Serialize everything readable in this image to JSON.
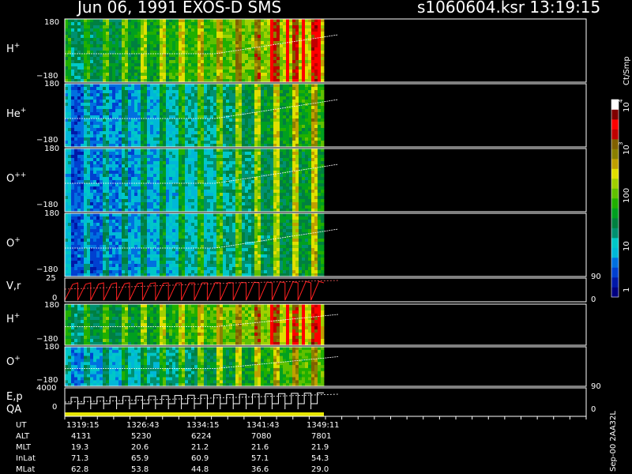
{
  "header": {
    "title": "Jun 06, 1991   EXOS-D SMS",
    "file": "s1060604.ksr  13:19:15"
  },
  "colorbar": {
    "unit": "Ct/Smp",
    "colors": [
      "#000080",
      "#0018a8",
      "#0040d0",
      "#0070e0",
      "#00b8d8",
      "#00c8c8",
      "#009070",
      "#008040",
      "#00a020",
      "#20b000",
      "#60c000",
      "#a0d000",
      "#e0e000",
      "#c0a000",
      "#8a8000",
      "#806000",
      "#c00000",
      "#ff0000",
      "#800000",
      "#ffffff"
    ],
    "tick_labels": [
      "1",
      "10",
      "100",
      "10",
      "3",
      "10",
      "4"
    ]
  },
  "panels": [
    {
      "id": "h-plus",
      "species": "H",
      "charge": "+",
      "y_top": "180",
      "y_bottom": "−180"
    },
    {
      "id": "he-plus",
      "species": "He",
      "charge": "+",
      "y_top": "180",
      "y_bottom": "−180"
    },
    {
      "id": "o-plusplus",
      "species": "O",
      "charge": "++",
      "y_top": "180",
      "y_bottom": "−180"
    },
    {
      "id": "o-plus",
      "species": "O",
      "charge": "+",
      "y_top": "180",
      "y_bottom": "−180"
    },
    {
      "id": "vr",
      "label": "V,r",
      "y_top": "25",
      "y_bottom": "0",
      "right_top": "90",
      "right_bottom": "0"
    },
    {
      "id": "h-plus-2",
      "species": "H",
      "charge": "+",
      "y_top": "180",
      "y_bottom": "−180"
    },
    {
      "id": "o-plus-2",
      "species": "O",
      "charge": "+",
      "y_top": "180",
      "y_bottom": "−180"
    },
    {
      "id": "ep-qa",
      "label": "E,p",
      "label2": "QA",
      "y_top": "4000",
      "y_bottom": "0",
      "right_top": "90",
      "right_bottom": "0"
    }
  ],
  "footer": {
    "rows": [
      {
        "name": "UT",
        "values": [
          "1319:15",
          "1326:43",
          "1334:15",
          "1341:43",
          "1349:11"
        ]
      },
      {
        "name": "ALT",
        "values": [
          "4131",
          "5230",
          "6224",
          "7080",
          "7801"
        ]
      },
      {
        "name": "MLT",
        "values": [
          "19.3",
          "20.6",
          "21.2",
          "21.6",
          "21.9"
        ]
      },
      {
        "name": "InLat",
        "values": [
          "71.3",
          "65.9",
          "60.9",
          "57.1",
          "54.3"
        ]
      },
      {
        "name": "MLat",
        "values": [
          "62.8",
          "53.8",
          "44.8",
          "36.6",
          "29.0"
        ]
      }
    ],
    "stamp": "Sep-00  2AA32L"
  },
  "chart_data": {
    "type": "heatmap",
    "title": "Jun 06, 1991   EXOS-D SMS",
    "x": {
      "label": "UT",
      "tick_labels": [
        "1319:15",
        "1326:43",
        "1334:15",
        "1341:43",
        "1349:11"
      ]
    },
    "colorbar": {
      "label": "Ct/Smp",
      "scale": "log",
      "range": [
        1,
        10000
      ],
      "ticks": [
        1,
        10,
        100,
        1000,
        10000
      ]
    },
    "spectrograms": [
      {
        "name": "H+",
        "y_range": [
          -180,
          180
        ]
      },
      {
        "name": "He+",
        "y_range": [
          -180,
          180
        ]
      },
      {
        "name": "O++",
        "y_range": [
          -180,
          180
        ]
      },
      {
        "name": "O+",
        "y_range": [
          -180,
          180
        ]
      },
      {
        "name": "H+ (2)",
        "y_range": [
          -180,
          180
        ]
      },
      {
        "name": "O+ (2)",
        "y_range": [
          -180,
          180
        ]
      }
    ],
    "line_panels": [
      {
        "name": "V,r",
        "y_range": [
          0,
          25
        ],
        "right_range": [
          0,
          90
        ]
      },
      {
        "name": "E,p",
        "y_range": [
          0,
          4000
        ],
        "right_range": [
          0,
          90
        ]
      }
    ]
  }
}
